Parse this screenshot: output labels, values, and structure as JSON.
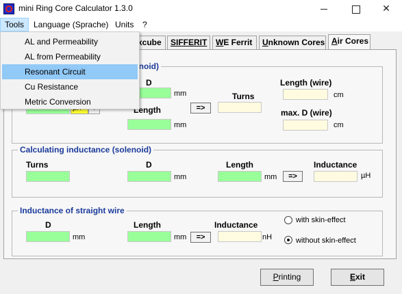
{
  "window": {
    "title": "mini Ring Core Calculator 1.3.0"
  },
  "menubar": {
    "tools": "Tools",
    "language": "Language (Sprache)",
    "units": "Units",
    "help": "?"
  },
  "tools_menu": {
    "items": [
      "AL and Permeability",
      "AL from Permeability",
      "Resonant Circuit",
      "Cu Resistance",
      "Metric Conversion"
    ],
    "highlighted_index": 2
  },
  "tabs": {
    "excube_partial": "xcube",
    "sifferit": "SIFFERIT",
    "weferrit_prefix": "W",
    "weferrit_rest": "E Ferrit",
    "unknown_prefix": "U",
    "unknown_rest": "nknown Cores",
    "aircores_prefix": "A",
    "aircores_rest": "ir Cores",
    "active": "Air Cores"
  },
  "group1": {
    "title_partial": "enoid)",
    "d_label": "D",
    "d_unit": "mm",
    "length_label": "Length",
    "length_unit": "mm",
    "turns_label": "Turns",
    "calc_button": "=>",
    "wire_length_label": "Length (wire)",
    "wire_length_unit": "cm",
    "max_d_label": "max. D (wire)",
    "max_d_unit": "cm",
    "inductance_unit_partial": "µH"
  },
  "group2": {
    "title": "Calculating inductance (solenoid)",
    "turns_label": "Turns",
    "d_label": "D",
    "d_unit": "mm",
    "length_label": "Length",
    "length_unit": "mm",
    "calc_button": "=>",
    "inductance_label": "Inductance",
    "inductance_unit": "µH"
  },
  "group3": {
    "title": "Inductance of straight wire",
    "d_label": "D",
    "d_unit": "mm",
    "length_label": "Length",
    "length_unit": "mm",
    "calc_button": "=>",
    "inductance_label": "Inductance",
    "inductance_unit": "nH",
    "skin_with": "with skin-effect",
    "skin_without": "without skin-effect",
    "skin_selected": "without skin-effect"
  },
  "footer": {
    "printing_prefix": "P",
    "printing_rest": "rinting",
    "exit_prefix": "E",
    "exit_rest": "xit"
  },
  "colors": {
    "input_bg": "#99ff99",
    "output_bg": "#fffbe0",
    "group_title": "#1a3a9a",
    "menu_highlight": "#91c9f7"
  }
}
